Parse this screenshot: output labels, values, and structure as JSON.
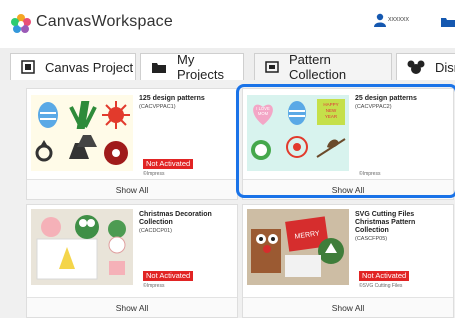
{
  "app": {
    "title": "CanvasWorkspace",
    "user_name": "xxxxxx"
  },
  "tabs": [
    {
      "label": "Canvas Project",
      "icon": "canvas-project-icon"
    },
    {
      "label": "My Projects",
      "icon": "folder-icon"
    },
    {
      "label": "Pattern Collection",
      "icon": "pattern-collection-icon"
    },
    {
      "label": "Disney",
      "icon": "mickey-icon"
    }
  ],
  "collections": [
    {
      "title_lines": [
        "125 design patterns"
      ],
      "code": "(CACVPPAC1)",
      "status": "Not Activated",
      "brand": "©Impress",
      "action": "Show All"
    },
    {
      "title_lines": [
        "25 design patterns"
      ],
      "code": "(CACVPPAC2)",
      "status": "",
      "brand": "©Impress",
      "action": "Show All"
    },
    {
      "title_lines": [
        "Christmas Decoration",
        "Collection"
      ],
      "code": "(CACDCP01)",
      "status": "Not Activated",
      "brand": "©Impress",
      "action": "Show All"
    },
    {
      "title_lines": [
        "SVG Cutting Files",
        "Christmas Pattern",
        "Collection"
      ],
      "code": "(CASCFP05)",
      "status": "Not Activated",
      "brand": "©SVG Cutting Files",
      "action": "Show All"
    }
  ],
  "thumbnail_text": {
    "love_mom": [
      "I LOVE",
      "MOM"
    ],
    "happy_new_year": [
      "HAPPY",
      "NEW",
      "YEAR"
    ],
    "merry": "MERRY"
  },
  "colors": {
    "accent": "#1a73e8",
    "badge": "#e12424"
  }
}
